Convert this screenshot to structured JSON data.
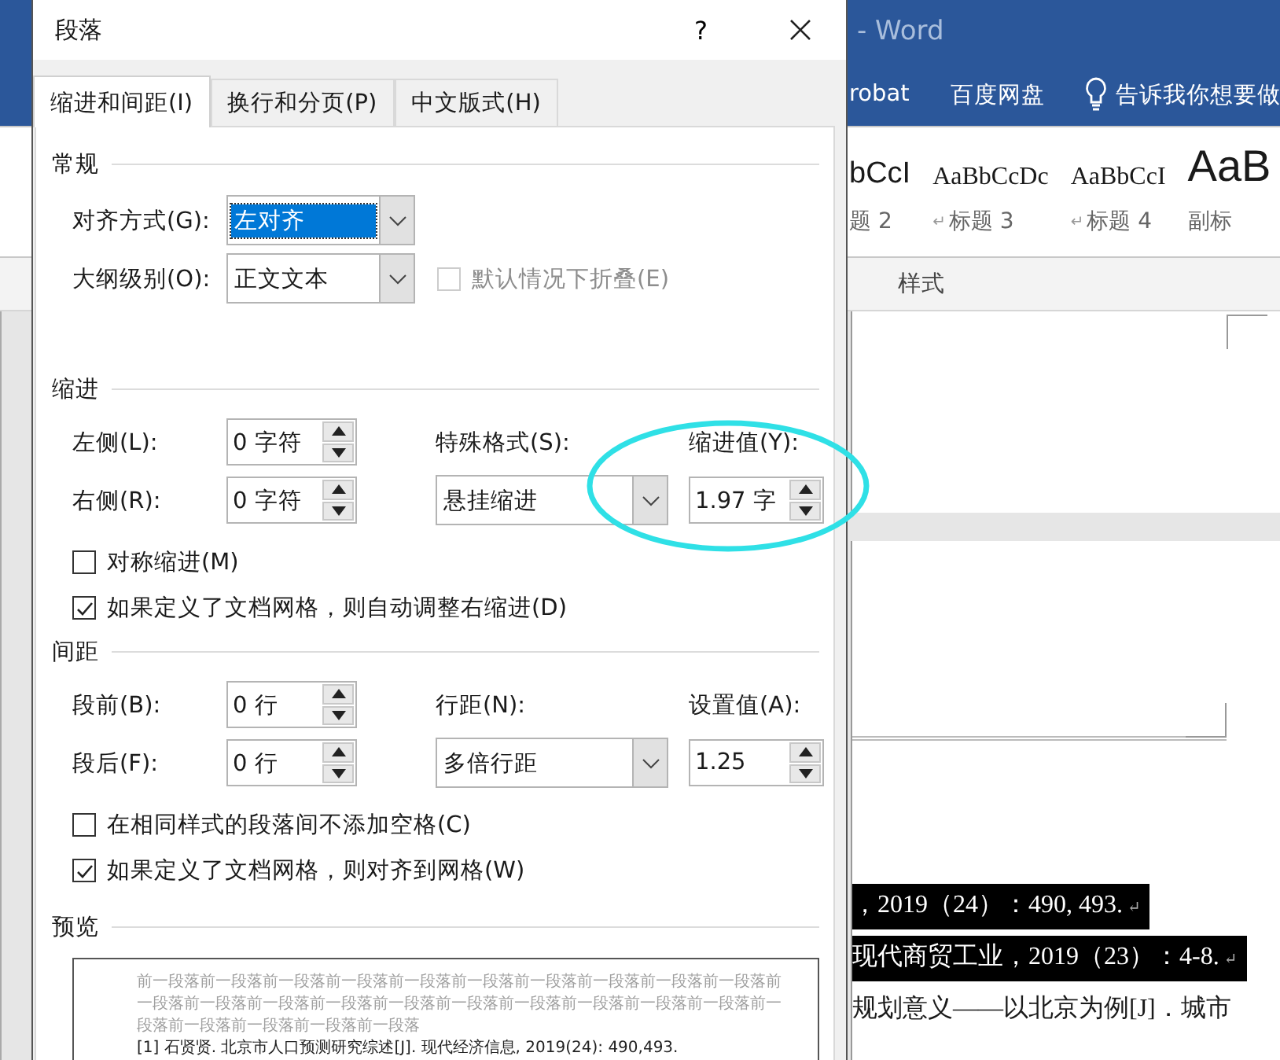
{
  "word": {
    "title": "- Word",
    "ribbon_tabs": [
      "robat",
      "百度网盘"
    ],
    "tell_me": "告诉我你想要做",
    "styles": [
      {
        "kind": "sans",
        "preview": "bCcI",
        "name": "题 2"
      },
      {
        "kind": "serif",
        "preview": "AaBbCcDc",
        "mark": "↵",
        "name": "标题 3"
      },
      {
        "kind": "serif",
        "preview": "AaBbCcI",
        "mark": "↵",
        "name": "标题 4"
      },
      {
        "kind": "large",
        "preview": "AaB",
        "name": "副标"
      }
    ],
    "styles_label": "样式",
    "document_lines": [
      {
        "text": "，2019（24）：490, 493.",
        "mark": "↵",
        "selected": true
      },
      {
        "text": "现代商贸工业，2019（23）：4-8.",
        "mark": "↵",
        "selected": true
      },
      {
        "text": "规划意义——以北京为例[J]．城市",
        "selected": false
      }
    ]
  },
  "dialog": {
    "title": "段落",
    "help": "?",
    "tabs": [
      {
        "label": "缩进和间距(I)",
        "selected": true
      },
      {
        "label": "换行和分页(P)",
        "selected": false
      },
      {
        "label": "中文版式(H)",
        "selected": false
      }
    ],
    "general": {
      "heading": "常规",
      "alignment": {
        "label": "对齐方式(G):",
        "value": "左对齐",
        "selected": true
      },
      "outline_level": {
        "label": "大纲级别(O):",
        "value": "正文文本",
        "selected": false
      },
      "collapse": {
        "label": "默认情况下折叠(E)",
        "checked": false,
        "disabled": true
      }
    },
    "indentation": {
      "heading": "缩进",
      "left": {
        "label": "左侧(L):",
        "value": "0 字符"
      },
      "right": {
        "label": "右侧(R):",
        "value": "0 字符"
      },
      "special": {
        "label": "特殊格式(S):",
        "value": "悬挂缩进"
      },
      "by": {
        "label": "缩进值(Y):",
        "value": "1.97 字"
      },
      "mirror": {
        "label": "对称缩进(M)",
        "checked": false,
        "disabled": false
      },
      "auto_adjust": {
        "label": "如果定义了文档网格，则自动调整右缩进(D)",
        "checked": true,
        "disabled": false
      }
    },
    "spacing": {
      "heading": "间距",
      "before": {
        "label": "段前(B):",
        "value": "0 行"
      },
      "after": {
        "label": "段后(F):",
        "value": "0 行"
      },
      "line_spacing": {
        "label": "行距(N):",
        "value": "多倍行距"
      },
      "at": {
        "label": "设置值(A):",
        "value": "1.25"
      },
      "no_space": {
        "label": "在相同样式的段落间不添加空格(C)",
        "checked": false,
        "disabled": false
      },
      "snap": {
        "label": "如果定义了文档网格，则对齐到网格(W)",
        "checked": true,
        "disabled": false
      }
    },
    "preview": {
      "heading": "预览",
      "previous_lines": [
        "前一段落前一段落前一段落前一段落前一段落前一段落前一段落前一段落前一段落前一段落前",
        "一段落前一段落前一段落前一段落前一段落前一段落前一段落前一段落前一段落前一段落前一",
        "段落前一段落前一段落前一段落前一段落"
      ],
      "current_lines": [
        "[1] 石贤贤. 北京市人口预测研究综述[J]. 现代经济信息, 2019(24): 490,493."
      ]
    }
  }
}
